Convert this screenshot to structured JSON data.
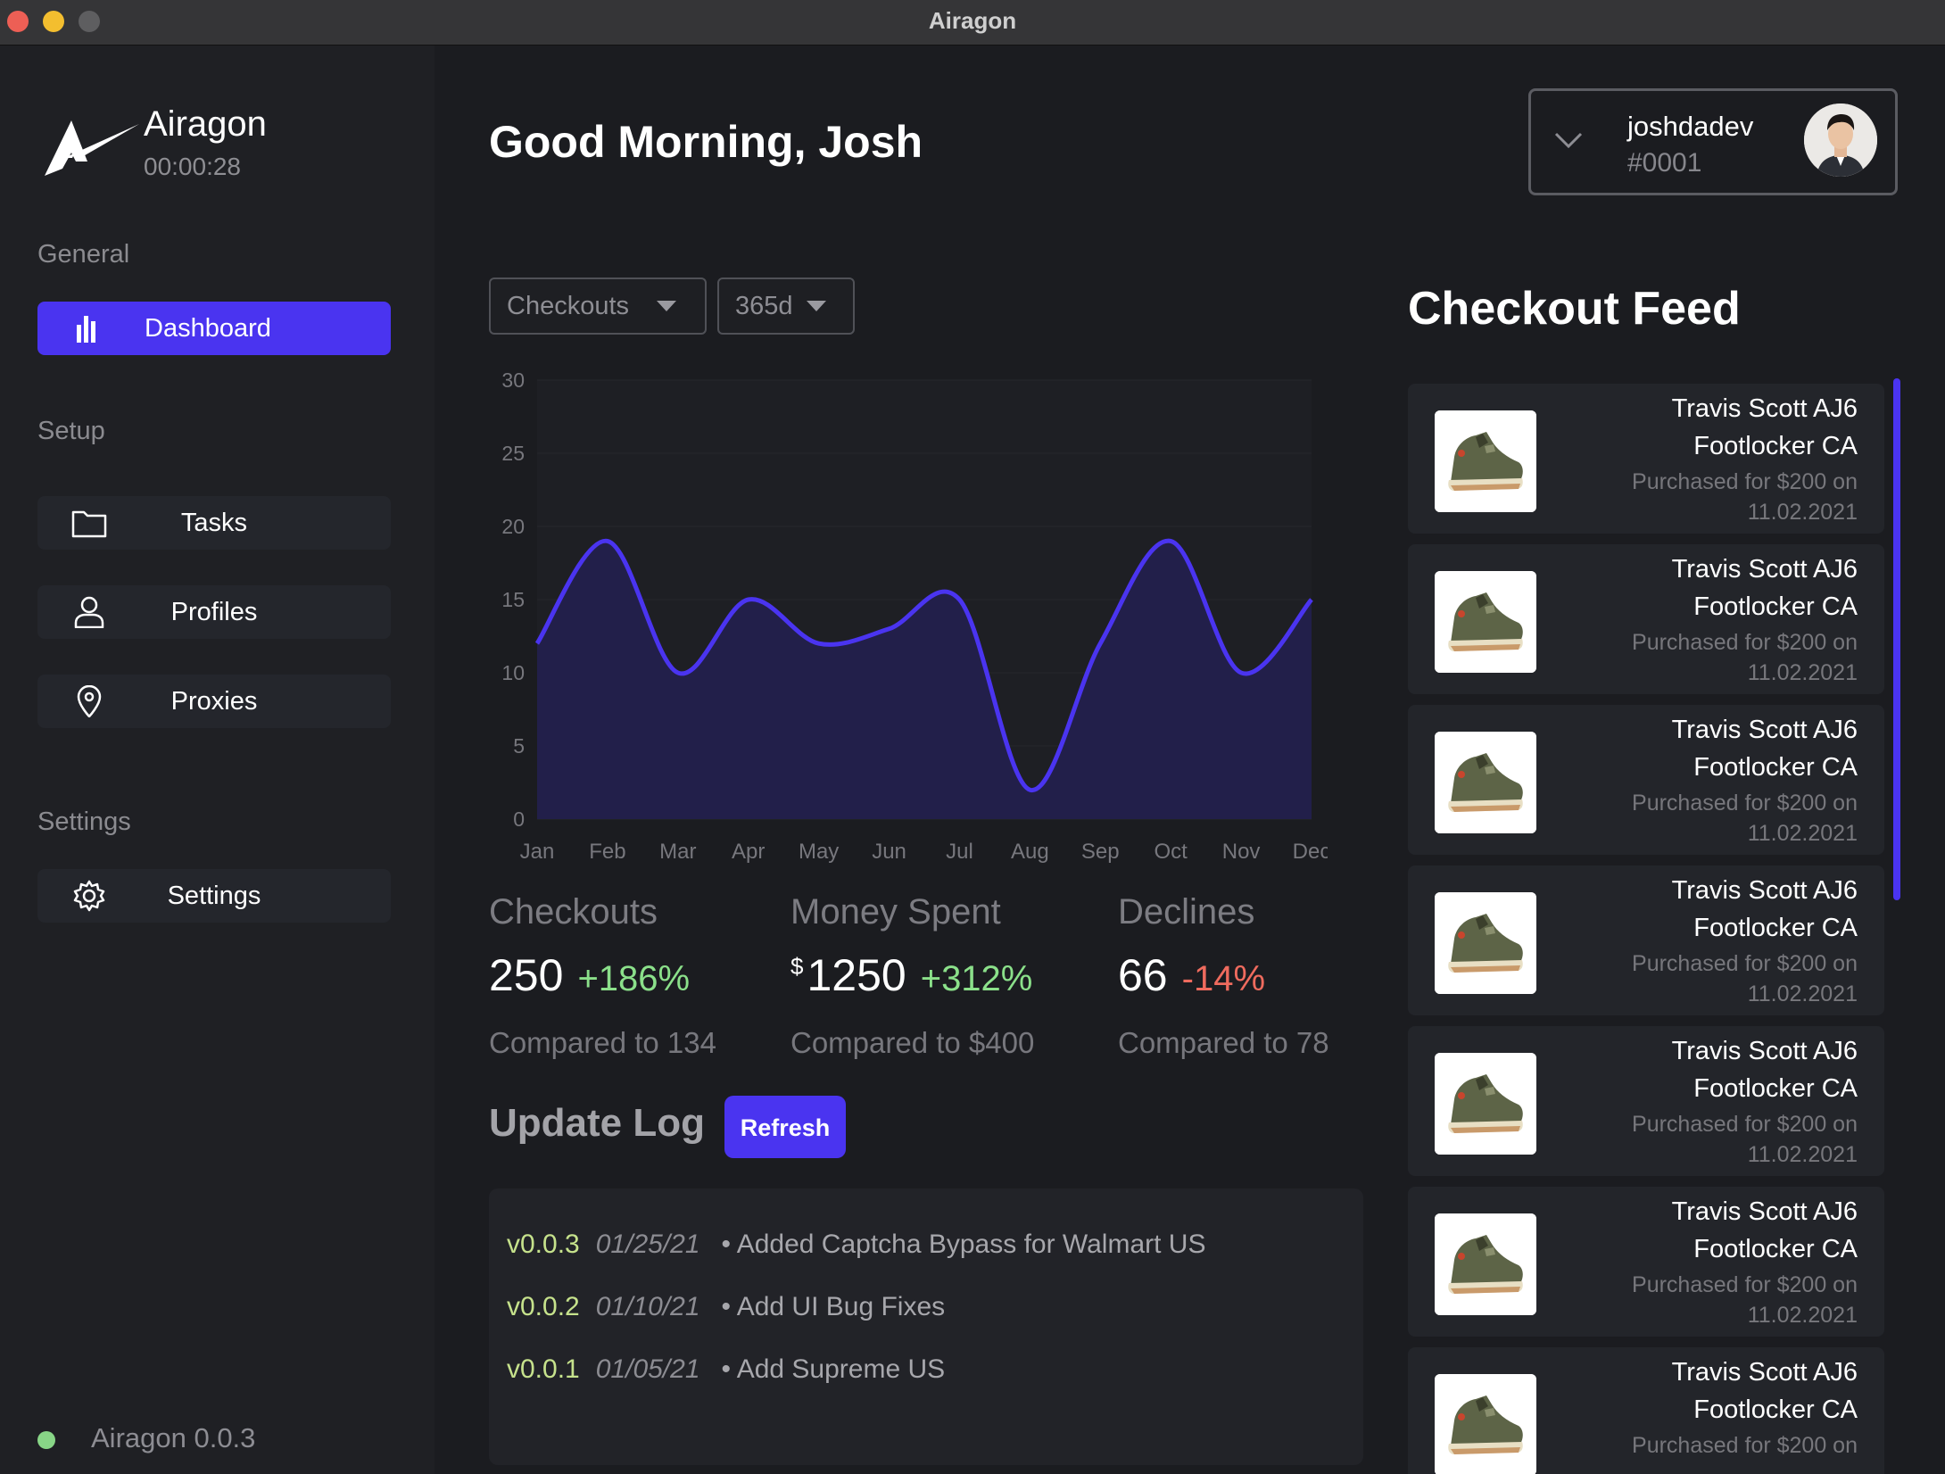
{
  "window": {
    "title": "Airagon"
  },
  "brand": {
    "name": "Airagon",
    "timer": "00:00:28"
  },
  "sidebar": {
    "sections": {
      "general": "General",
      "setup": "Setup",
      "settings": "Settings"
    },
    "items": {
      "dashboard": "Dashboard",
      "tasks": "Tasks",
      "profiles": "Profiles",
      "proxies": "Proxies",
      "settings": "Settings"
    },
    "version": "Airagon 0.0.3"
  },
  "header": {
    "greeting": "Good Morning, Josh"
  },
  "user": {
    "name": "joshdadev",
    "tag": "#0001"
  },
  "filters": {
    "metric": "Checkouts",
    "range": "365d"
  },
  "chart_data": {
    "type": "area",
    "categories": [
      "Jan",
      "Feb",
      "Mar",
      "Apr",
      "May",
      "Jun",
      "Jul",
      "Aug",
      "Sep",
      "Oct",
      "Nov",
      "Dec"
    ],
    "series": [
      {
        "values": [
          12,
          19,
          10,
          15,
          12,
          13,
          15,
          2,
          12,
          19,
          10,
          15
        ]
      }
    ],
    "ylim": [
      0,
      30
    ],
    "yticks": [
      0,
      5,
      10,
      15,
      20,
      25,
      30
    ],
    "title": "",
    "xlabel": "",
    "ylabel": "",
    "colors": {
      "line": "#4a34f0",
      "fill": "#221f4a"
    },
    "grid": true
  },
  "stats": {
    "checkouts": {
      "title": "Checkouts",
      "value": "250",
      "change": "+186%",
      "compare": "Compared to 134"
    },
    "money": {
      "title": "Money Spent",
      "currency": "$",
      "value": "1250",
      "change": "+312%",
      "compare": "Compared to $400"
    },
    "declines": {
      "title": "Declines",
      "value": "66",
      "change": "-14%",
      "compare": "Compared to 78"
    }
  },
  "update_log": {
    "title": "Update Log",
    "refresh_label": "Refresh",
    "entries": [
      {
        "version": "v0.0.3",
        "date": "01/25/21",
        "text": "• Added Captcha Bypass for Walmart US"
      },
      {
        "version": "v0.0.2",
        "date": "01/10/21",
        "text": "• Add UI Bug Fixes"
      },
      {
        "version": "v0.0.1",
        "date": "01/05/21",
        "text": "• Add Supreme US"
      }
    ]
  },
  "feed": {
    "title": "Checkout Feed",
    "items": [
      {
        "product": "Travis Scott AJ6",
        "store": "Footlocker CA",
        "price": "Purchased for $200 on",
        "date": "11.02.2021"
      },
      {
        "product": "Travis Scott AJ6",
        "store": "Footlocker CA",
        "price": "Purchased for $200 on",
        "date": "11.02.2021"
      },
      {
        "product": "Travis Scott AJ6",
        "store": "Footlocker CA",
        "price": "Purchased for $200 on",
        "date": "11.02.2021"
      },
      {
        "product": "Travis Scott AJ6",
        "store": "Footlocker CA",
        "price": "Purchased for $200 on",
        "date": "11.02.2021"
      },
      {
        "product": "Travis Scott AJ6",
        "store": "Footlocker CA",
        "price": "Purchased for $200 on",
        "date": "11.02.2021"
      },
      {
        "product": "Travis Scott AJ6",
        "store": "Footlocker CA",
        "price": "Purchased for $200 on",
        "date": "11.02.2021"
      },
      {
        "product": "Travis Scott AJ6",
        "store": "Footlocker CA",
        "price": "Purchased for $200 on",
        "date": ""
      }
    ]
  },
  "colors": {
    "accent": "#4a34f0",
    "positive": "#8be08a",
    "negative": "#ef6b5e",
    "status_online": "#88d687"
  }
}
